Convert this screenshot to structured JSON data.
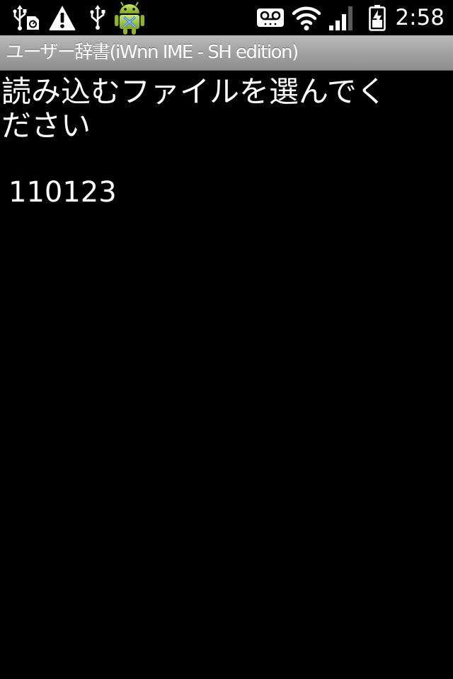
{
  "status_bar": {
    "time": "2:58",
    "icons": [
      "usb-sd-icon",
      "warning-icon",
      "usb-icon",
      "android-debug-icon",
      "voicemail-icon",
      "wifi-icon",
      "signal-icon",
      "battery-charging-icon"
    ]
  },
  "title_bar": {
    "title": "ユーザー辞書(iWnn IME - SH edition)"
  },
  "content": {
    "prompt": "読み込むファイルを選んでください",
    "files": [
      {
        "name": "110123"
      }
    ]
  },
  "colors": {
    "background": "#000000",
    "text": "#ffffff",
    "title_bar": "#a4a4a4",
    "android_green": "#a4c639"
  }
}
